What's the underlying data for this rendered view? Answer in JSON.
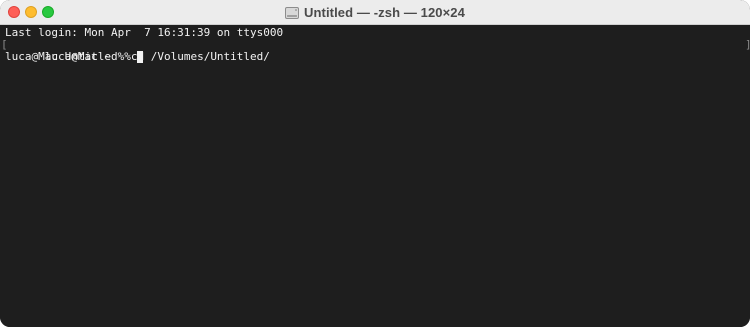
{
  "window": {
    "title": "Untitled — -zsh — 120×24"
  },
  "terminal": {
    "lines": [
      "Last login: Mon Apr  7 16:31:39 on ttys000",
      "luca@Mac ~ % cd /Volumes/Untitled/"
    ],
    "prompt": "luca@Mac Untitled % ",
    "mark_left": "[",
    "mark_right": "]"
  },
  "colors": {
    "background": "#1e1e1e",
    "foreground": "#f2f2f2",
    "titlebar": "#ececec",
    "close": "#fe5f57",
    "minimize": "#febc2e",
    "zoom": "#28c840"
  },
  "icons": {
    "title_icon": "disk-icon"
  }
}
